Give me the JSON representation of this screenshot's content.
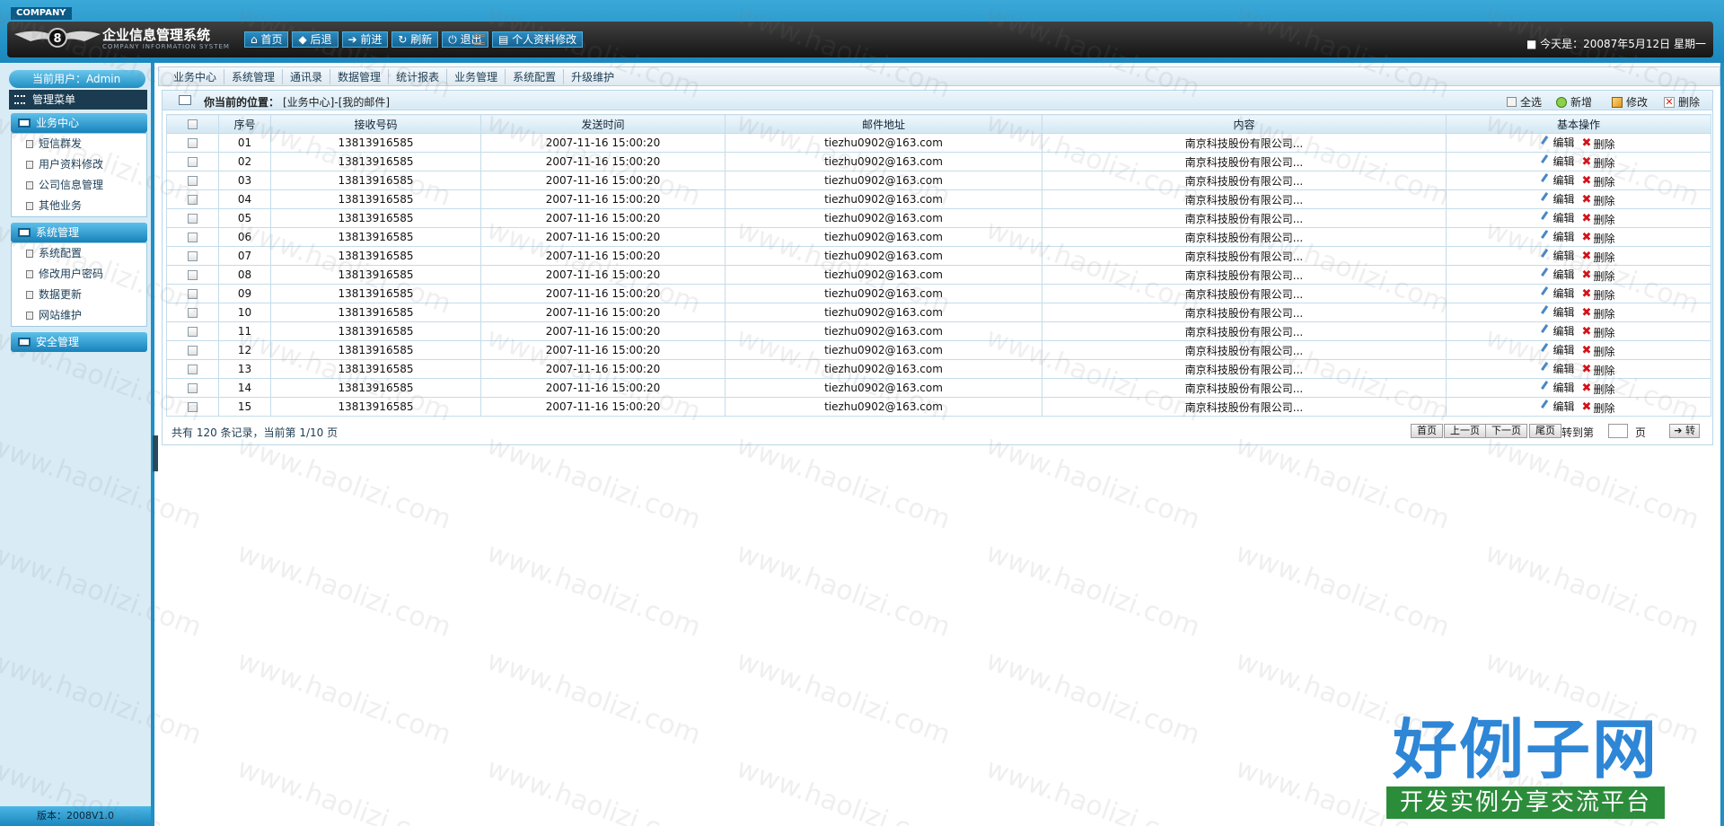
{
  "header": {
    "company_tab": "COMPANY",
    "title": "企业信息管理系统",
    "subtitle": "COMPANY INFORMATION SYSTEM",
    "toolbar": [
      "首页",
      "后退",
      "前进",
      "刷新",
      "退出"
    ],
    "profile_button": "个人资料修改",
    "date_text": "今天是：20087年5月12日 星期一"
  },
  "sidebar": {
    "current_user": "当前用户：Admin",
    "menu_title": "管理菜单",
    "groups": [
      {
        "title": "业务中心",
        "items": [
          "短信群发",
          "用户资料修改",
          "公司信息管理",
          "其他业务"
        ]
      },
      {
        "title": "系统管理",
        "items": [
          "系统配置",
          "修改用户密码",
          "数据更新",
          "网站维护"
        ]
      },
      {
        "title": "安全管理",
        "items": []
      }
    ],
    "version": "版本：2008V1.0"
  },
  "nav_tabs": [
    "业务中心",
    "系统管理",
    "通讯录",
    "数据管理",
    "统计报表",
    "业务管理",
    "系统配置",
    "升级维护"
  ],
  "location": {
    "label": "你当前的位置：",
    "path": "[业务中心]-[我的邮件]"
  },
  "actions": {
    "select_all": "全选",
    "add": "新增",
    "edit": "修改",
    "delete": "删除"
  },
  "table": {
    "columns": [
      "序号",
      "接收号码",
      "发送时间",
      "邮件地址",
      "内容",
      "基本操作"
    ],
    "edit_label": "编辑",
    "delete_label": "删除",
    "rows": [
      [
        "01",
        "13813916585",
        "2007-11-16 15:00:20",
        "tiezhu0902@163.com",
        "南京科技股份有限公司..."
      ],
      [
        "02",
        "13813916585",
        "2007-11-16 15:00:20",
        "tiezhu0902@163.com",
        "南京科技股份有限公司..."
      ],
      [
        "03",
        "13813916585",
        "2007-11-16 15:00:20",
        "tiezhu0902@163.com",
        "南京科技股份有限公司..."
      ],
      [
        "04",
        "13813916585",
        "2007-11-16 15:00:20",
        "tiezhu0902@163.com",
        "南京科技股份有限公司..."
      ],
      [
        "05",
        "13813916585",
        "2007-11-16 15:00:20",
        "tiezhu0902@163.com",
        "南京科技股份有限公司..."
      ],
      [
        "06",
        "13813916585",
        "2007-11-16 15:00:20",
        "tiezhu0902@163.com",
        "南京科技股份有限公司..."
      ],
      [
        "07",
        "13813916585",
        "2007-11-16 15:00:20",
        "tiezhu0902@163.com",
        "南京科技股份有限公司..."
      ],
      [
        "08",
        "13813916585",
        "2007-11-16 15:00:20",
        "tiezhu0902@163.com",
        "南京科技股份有限公司..."
      ],
      [
        "09",
        "13813916585",
        "2007-11-16 15:00:20",
        "tiezhu0902@163.com",
        "南京科技股份有限公司..."
      ],
      [
        "10",
        "13813916585",
        "2007-11-16 15:00:20",
        "tiezhu0902@163.com",
        "南京科技股份有限公司..."
      ],
      [
        "11",
        "13813916585",
        "2007-11-16 15:00:20",
        "tiezhu0902@163.com",
        "南京科技股份有限公司..."
      ],
      [
        "12",
        "13813916585",
        "2007-11-16 15:00:20",
        "tiezhu0902@163.com",
        "南京科技股份有限公司..."
      ],
      [
        "13",
        "13813916585",
        "2007-11-16 15:00:20",
        "tiezhu0902@163.com",
        "南京科技股份有限公司..."
      ],
      [
        "14",
        "13813916585",
        "2007-11-16 15:00:20",
        "tiezhu0902@163.com",
        "南京科技股份有限公司..."
      ],
      [
        "15",
        "13813916585",
        "2007-11-16 15:00:20",
        "tiezhu0902@163.com",
        "南京科技股份有限公司..."
      ]
    ]
  },
  "pager": {
    "summary": "共有 120 条记录，当前第 1/10 页",
    "first": "首页",
    "prev": "上一页",
    "next": "下一页",
    "last": "尾页",
    "goto_label": "转到第",
    "goto_unit": "页",
    "go": "➔ 转"
  },
  "watermark": {
    "text": "www.haolizi.com",
    "brand": "好例子网",
    "brand_sub": "开发实例分享交流平台"
  }
}
